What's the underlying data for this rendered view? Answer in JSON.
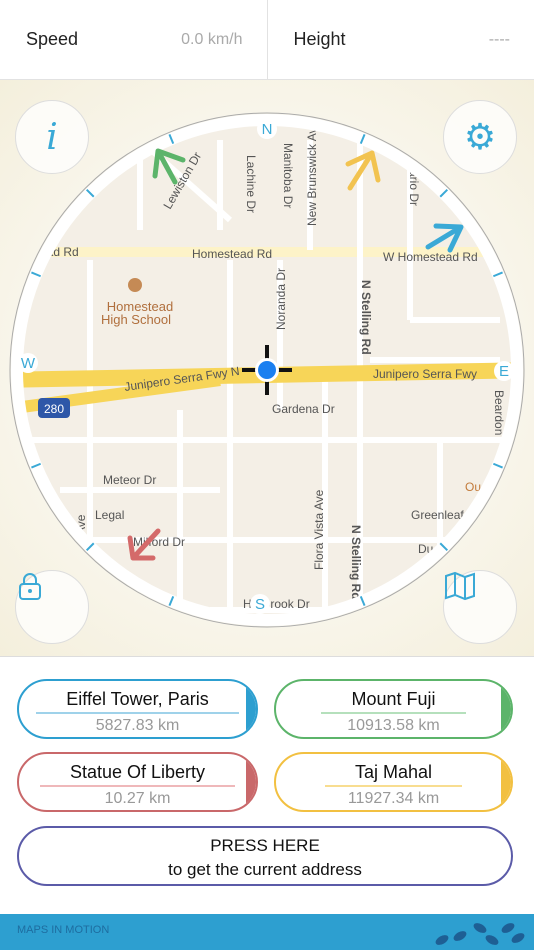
{
  "header": {
    "speed_label": "Speed",
    "speed_value": "0.0 km/h",
    "height_label": "Height",
    "height_value": "----"
  },
  "compass": {
    "n": "N",
    "s": "S",
    "e": "E",
    "w": "W"
  },
  "map": {
    "streets": {
      "homestead_left": "ead Rd",
      "homestead": "Homestead Rd",
      "w_homestead": "W Homestead Rd",
      "junipero_left": "Junipero Serra Fwy N",
      "junipero_right": "Junipero Serra Fwy",
      "gardena": "Gardena Dr",
      "meteor": "Meteor Dr",
      "legal": "Legal",
      "milford": "Milford Dr",
      "hollbrook": "Hollbrook Dr",
      "greenleaf": "Greenleaf",
      "du": "Du",
      "flora_vista": "Flora Vista Ave",
      "n_stelling": "N Stelling Rd",
      "n_stelling2": "N Stelling Rd",
      "noranda": "Noranda Dr",
      "lachine": "Lachine Dr",
      "manitoba": "Manitoba Dr",
      "new_brunswick": "New Brunswick Av",
      "lewiston": "Lewiston Dr",
      "ontario": "ario Dr",
      "beardon": "Beardon",
      "ave": "Ave",
      "ou": "Ou",
      "highway_shield": "280"
    },
    "poi": {
      "school_line1": "Homestead",
      "school_line2": "High School"
    }
  },
  "arrows": {
    "green": "#5cb46a",
    "yellow": "#f2c350",
    "blue": "#3aa9d6",
    "red": "#d46a6a"
  },
  "destinations": [
    {
      "name": "Eiffel Tower, Paris",
      "distance": "5827.83 km",
      "color": "#2d9fd0"
    },
    {
      "name": "Mount Fuji",
      "distance": "10913.58 km",
      "color": "#5cb46a"
    },
    {
      "name": "Statue Of Liberty",
      "distance": "10.27 km",
      "color": "#c9686a"
    },
    {
      "name": "Taj Mahal",
      "distance": "11927.34 km",
      "color": "#f2c041"
    }
  ],
  "press": {
    "line1": "PRESS HERE",
    "line2": "to get the current address"
  },
  "footer": {
    "brand": "MAPS IN MOTION"
  }
}
